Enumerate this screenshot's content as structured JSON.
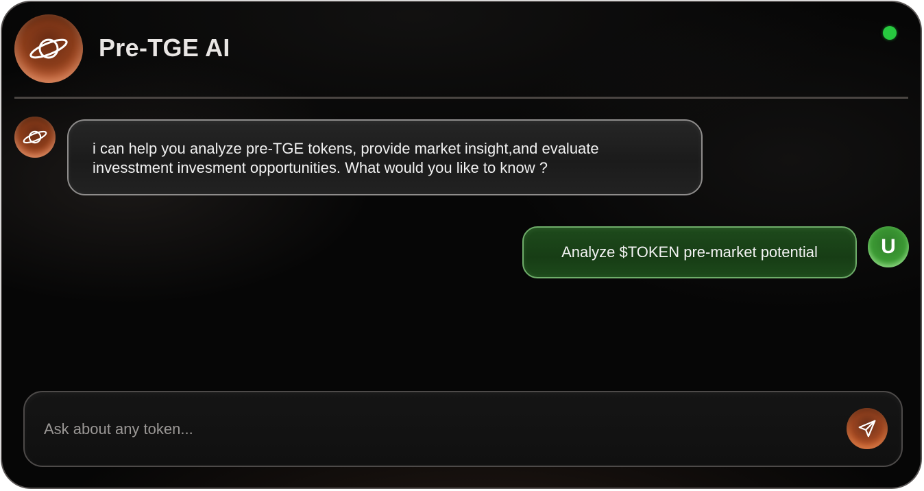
{
  "header": {
    "title": "Pre-TGE AI",
    "avatar_icon": "planet-icon",
    "status_color": "#27c93f"
  },
  "messages": [
    {
      "role": "assistant",
      "avatar_icon": "planet-icon",
      "lines": [
        "i can help you analyze pre-TGE tokens, provide market insight,and evaluate",
        "invesstment invesment opportunities. What would you like to know ?"
      ]
    },
    {
      "role": "user",
      "avatar_letter": "U",
      "text": "Analyze $TOKEN pre-market potential"
    }
  ],
  "composer": {
    "placeholder": "Ask about any token...",
    "value": "",
    "send_icon": "send-icon"
  },
  "colors": {
    "accent_orange": "#c8643a",
    "user_bubble_green": "#1e4a1c",
    "status_green": "#27c93f",
    "background": "#060606"
  }
}
